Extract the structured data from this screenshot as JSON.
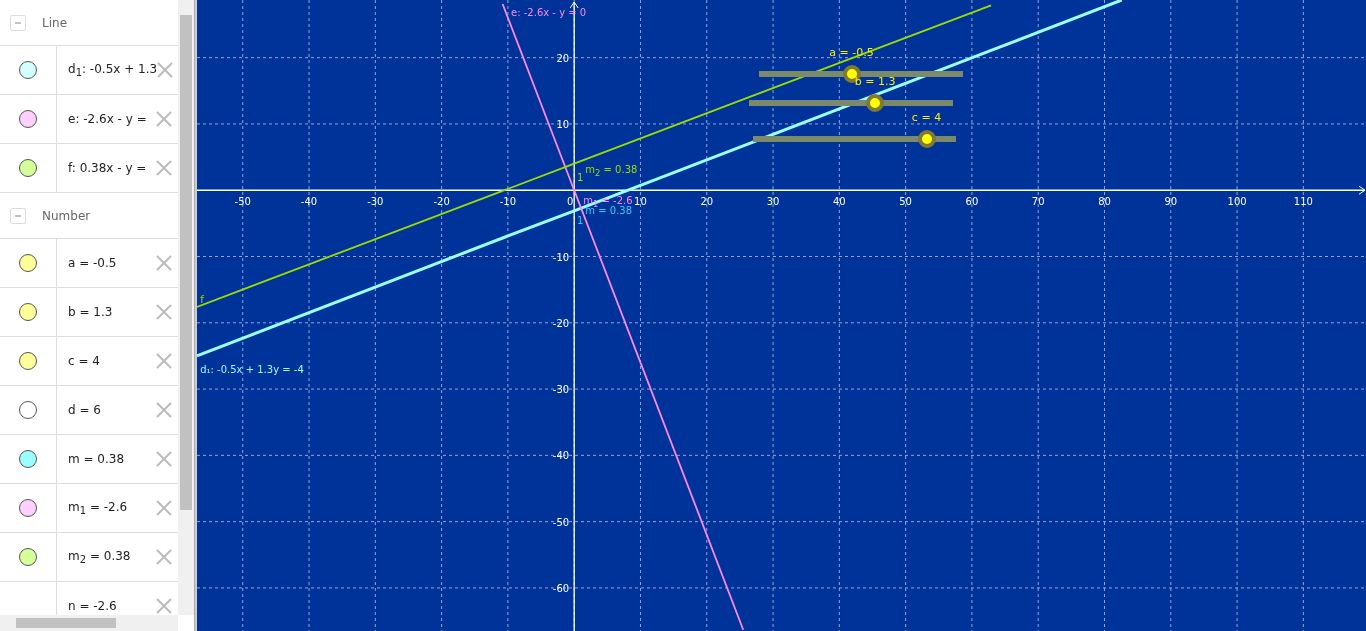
{
  "algebra": {
    "groups": [
      {
        "label": "Line",
        "expanded": true,
        "items": [
          {
            "text": "d$_{1}$: -0.5x + 1.3",
            "color": "#d4ffff"
          },
          {
            "text": "e: -2.6x - y =",
            "color": "#ffd0ff"
          },
          {
            "text": "f: 0.38x - y =",
            "color": "#d4ff99"
          }
        ]
      },
      {
        "label": "Number",
        "expanded": true,
        "items": [
          {
            "text": "a = -0.5",
            "color": "#ffff99"
          },
          {
            "text": "b = 1.3",
            "color": "#ffff99"
          },
          {
            "text": "c = 4",
            "color": "#ffff99"
          },
          {
            "text": "d = 6",
            "color": "#ffffff"
          },
          {
            "text": "m = 0.38",
            "color": "#99ffff"
          },
          {
            "text": "m$_{1}$ = -2.6",
            "color": "#ffd0ff"
          },
          {
            "text": "m$_{2}$ = 0.38",
            "color": "#d4ff99"
          },
          {
            "text": "n = -2.6"
          }
        ]
      }
    ]
  },
  "graphics": {
    "chart_data": {
      "type": "line",
      "grid": true,
      "x": [
        -56.9,
        -10.8,
        0,
        25.5,
        62.9,
        82.6
      ],
      "series": [
        {
          "name": "d₁: -0.5x + 1.3y = -4",
          "color": "#99ffff",
          "values": [
            -25.0,
            -7.2,
            -3.1,
            6.7,
            21.1,
            28.7
          ]
        },
        {
          "name": "e: -2.6x - y = 0",
          "color": "#ff88ee",
          "values": [
            null,
            28.1,
            0,
            -66.3,
            null,
            null
          ]
        },
        {
          "name": "f",
          "color": "#99dd00",
          "values": [
            -17.6,
            -0.1,
            4,
            13.7,
            27.9,
            null
          ]
        }
      ],
      "xlim": [
        -56.9,
        119.6
      ],
      "ylim": [
        -66.5,
        28.7
      ],
      "xticks": [
        -50,
        -40,
        -30,
        -20,
        -10,
        0,
        10,
        20,
        30,
        40,
        50,
        60,
        70,
        80,
        90,
        100,
        110
      ],
      "yticks": [
        -60,
        -50,
        -40,
        -30,
        -20,
        -10,
        10,
        20
      ]
    },
    "labels": [
      {
        "text": "m$_{2}$ = 0.38",
        "color": "#99dd00"
      },
      {
        "text": "1",
        "color": "#99dd00"
      },
      {
        "text": "m$_{1}$ = -2.6",
        "color": "#ff88ff"
      },
      {
        "text": "m = 0.38",
        "color": "#33ccee"
      },
      {
        "text": "1",
        "color": "#33ccee"
      }
    ],
    "sliders": [
      {
        "label": "a = -0.5",
        "level": 0.45
      },
      {
        "label": "b = 1.3",
        "level": 0.63
      },
      {
        "label": "c = 4",
        "level": 0.89
      }
    ]
  }
}
